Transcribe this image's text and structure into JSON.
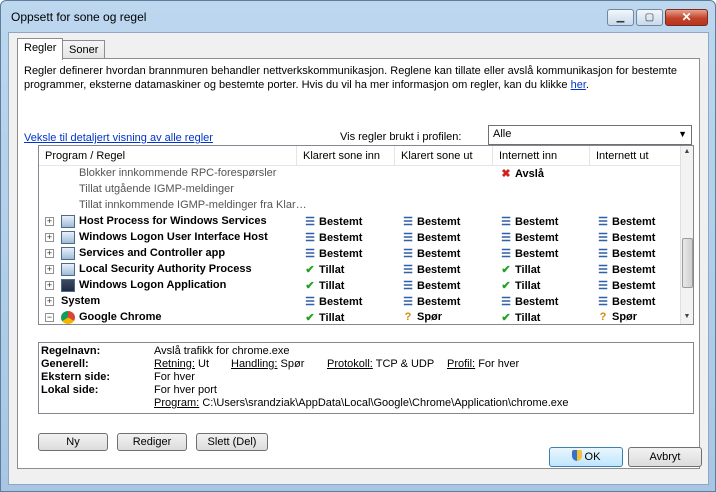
{
  "window": {
    "title": "Oppsett for sone og regel",
    "minimize_icon": "minimize-icon",
    "maximize_icon": "maximize-icon",
    "close_icon": "close-icon"
  },
  "tabs": [
    {
      "label": "Regler",
      "active": true
    },
    {
      "label": "Soner",
      "active": false
    }
  ],
  "description": {
    "text": "Regler definerer hvordan brannmuren behandler nettverkskommunikasjon. Reglene kan tillate eller avslå kommunikasjon for bestemte programmer, eksterne datamaskiner og bestemte porter. Hvis du vil ha mer informasjon om regler, kan du klikke ",
    "link": "her",
    "end": "."
  },
  "detail_link": "Veksle til detaljert visning av alle regler",
  "profile": {
    "label": "Vis regler brukt i profilen:",
    "value": "Alle"
  },
  "columns": [
    "Program / Regel",
    "Klarert sone inn",
    "Klarert sone ut",
    "Internett inn",
    "Internett ut"
  ],
  "rows": [
    {
      "name": "Blokker innkommende RPC-forespørsler",
      "level": "sub",
      "icon": "",
      "cells": [
        {
          "icon": "",
          "text": ""
        },
        {
          "icon": "",
          "text": ""
        },
        {
          "icon": "block-icon",
          "text": "Avslå"
        },
        {
          "icon": "",
          "text": ""
        }
      ]
    },
    {
      "name": "Tillat utgående IGMP-meldinger",
      "level": "sub",
      "icon": "",
      "cells": [
        {
          "icon": "",
          "text": ""
        },
        {
          "icon": "",
          "text": ""
        },
        {
          "icon": "",
          "text": ""
        },
        {
          "icon": "",
          "text": ""
        }
      ]
    },
    {
      "name": "Tillat innkommende IGMP-meldinger fra Klar…",
      "level": "sub",
      "icon": "",
      "cells": [
        {
          "icon": "",
          "text": ""
        },
        {
          "icon": "",
          "text": ""
        },
        {
          "icon": "",
          "text": ""
        },
        {
          "icon": "",
          "text": ""
        }
      ]
    },
    {
      "name": "Host Process for Windows Services",
      "level": "app",
      "icon": "application-window-icon",
      "cells": [
        {
          "icon": "bars-icon",
          "text": "Bestemt"
        },
        {
          "icon": "bars-icon",
          "text": "Bestemt"
        },
        {
          "icon": "bars-icon",
          "text": "Bestemt"
        },
        {
          "icon": "bars-icon",
          "text": "Bestemt"
        }
      ]
    },
    {
      "name": "Windows Logon User Interface Host",
      "level": "app",
      "icon": "application-window-icon",
      "cells": [
        {
          "icon": "bars-icon",
          "text": "Bestemt"
        },
        {
          "icon": "bars-icon",
          "text": "Bestemt"
        },
        {
          "icon": "bars-icon",
          "text": "Bestemt"
        },
        {
          "icon": "bars-icon",
          "text": "Bestemt"
        }
      ]
    },
    {
      "name": "Services and Controller app",
      "level": "app",
      "icon": "application-window-icon",
      "cells": [
        {
          "icon": "bars-icon",
          "text": "Bestemt"
        },
        {
          "icon": "bars-icon",
          "text": "Bestemt"
        },
        {
          "icon": "bars-icon",
          "text": "Bestemt"
        },
        {
          "icon": "bars-icon",
          "text": "Bestemt"
        }
      ]
    },
    {
      "name": "Local Security Authority Process",
      "level": "app",
      "icon": "application-window-icon",
      "cells": [
        {
          "icon": "check-icon",
          "text": "Tillat"
        },
        {
          "icon": "bars-icon",
          "text": "Bestemt"
        },
        {
          "icon": "check-icon",
          "text": "Tillat"
        },
        {
          "icon": "bars-icon",
          "text": "Bestemt"
        }
      ]
    },
    {
      "name": "Windows Logon Application",
      "level": "app",
      "icon": "logon-icon",
      "cells": [
        {
          "icon": "check-icon",
          "text": "Tillat"
        },
        {
          "icon": "bars-icon",
          "text": "Bestemt"
        },
        {
          "icon": "check-icon",
          "text": "Tillat"
        },
        {
          "icon": "bars-icon",
          "text": "Bestemt"
        }
      ]
    },
    {
      "name": "System",
      "level": "system",
      "icon": "",
      "cells": [
        {
          "icon": "bars-icon",
          "text": "Bestemt"
        },
        {
          "icon": "bars-icon",
          "text": "Bestemt"
        },
        {
          "icon": "bars-icon",
          "text": "Bestemt"
        },
        {
          "icon": "bars-icon",
          "text": "Bestemt"
        }
      ]
    },
    {
      "name": "Google Chrome",
      "level": "app-expanded",
      "icon": "chrome-icon",
      "cells": [
        {
          "icon": "check-icon",
          "text": "Tillat"
        },
        {
          "icon": "question-icon",
          "text": "Spør"
        },
        {
          "icon": "check-icon",
          "text": "Tillat"
        },
        {
          "icon": "question-icon",
          "text": "Spør"
        }
      ]
    }
  ],
  "details": {
    "rule_name_label": "Regelnavn:",
    "rule_name_value": "Avslå trafikk for chrome.exe",
    "general_label": "Generell:",
    "direction_label": "Retning:",
    "direction_value": "Ut",
    "action_label": "Handling:",
    "action_value": "Spør",
    "protocol_label": "Protokoll:",
    "protocol_value": "TCP & UDP",
    "profile_label": "Profil:",
    "profile_value": "For hver",
    "remote_label": "Ekstern side:",
    "remote_value": "For hver",
    "local_label": "Lokal side:",
    "local_value": "For hver port",
    "program_label": "Program:",
    "program_value": "C:\\Users\\srandziak\\AppData\\Local\\Google\\Chrome\\Application\\chrome.exe"
  },
  "buttons": {
    "new": "Ny",
    "edit": "Rediger",
    "delete": "Slett (Del)",
    "ok": "OK",
    "cancel": "Avbryt"
  },
  "colors": {
    "allow": "#23a023",
    "deny": "#d0221e",
    "ask": "#d88a00",
    "custom": "#2e5fa8",
    "link": "#0033cc"
  }
}
